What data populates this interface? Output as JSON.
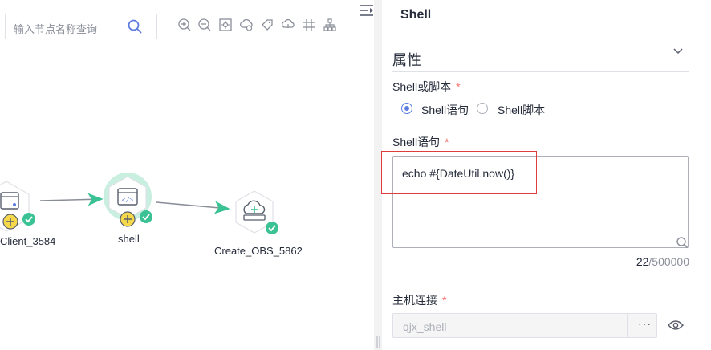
{
  "canvas": {
    "search": {
      "placeholder": "输入节点名称查询"
    },
    "toolbar": [
      "zoom-in-icon",
      "zoom-out-icon",
      "fit-view-icon",
      "cloud-node-icon",
      "tag-icon",
      "cloud-service-icon",
      "grid-icon",
      "tree-layout-icon"
    ],
    "nodes": [
      {
        "label": "Client_3584",
        "status": "success"
      },
      {
        "label": "shell",
        "status": "success",
        "selected": true
      },
      {
        "label": "Create_OBS_5862",
        "status": "success"
      }
    ]
  },
  "panel": {
    "title": "Shell",
    "section_title": "属性",
    "script_type": {
      "label": "Shell或脚本",
      "required_mark": "*",
      "options": [
        "Shell语句",
        "Shell脚本"
      ],
      "selected": "Shell语句"
    },
    "statement": {
      "label": "Shell语句",
      "required_mark": "*",
      "value": "echo #{DateUtil.now()}",
      "count": "22",
      "max": "/500000"
    },
    "host": {
      "label": "主机连接",
      "required_mark": "*",
      "value": "qjx_shell",
      "more": "···"
    }
  },
  "colors": {
    "accent": "#5e7ce0",
    "required": "#f66f6a",
    "success": "#3ac295",
    "node_ring": "#c8efe0",
    "highlight_box": "#e03c3c"
  }
}
